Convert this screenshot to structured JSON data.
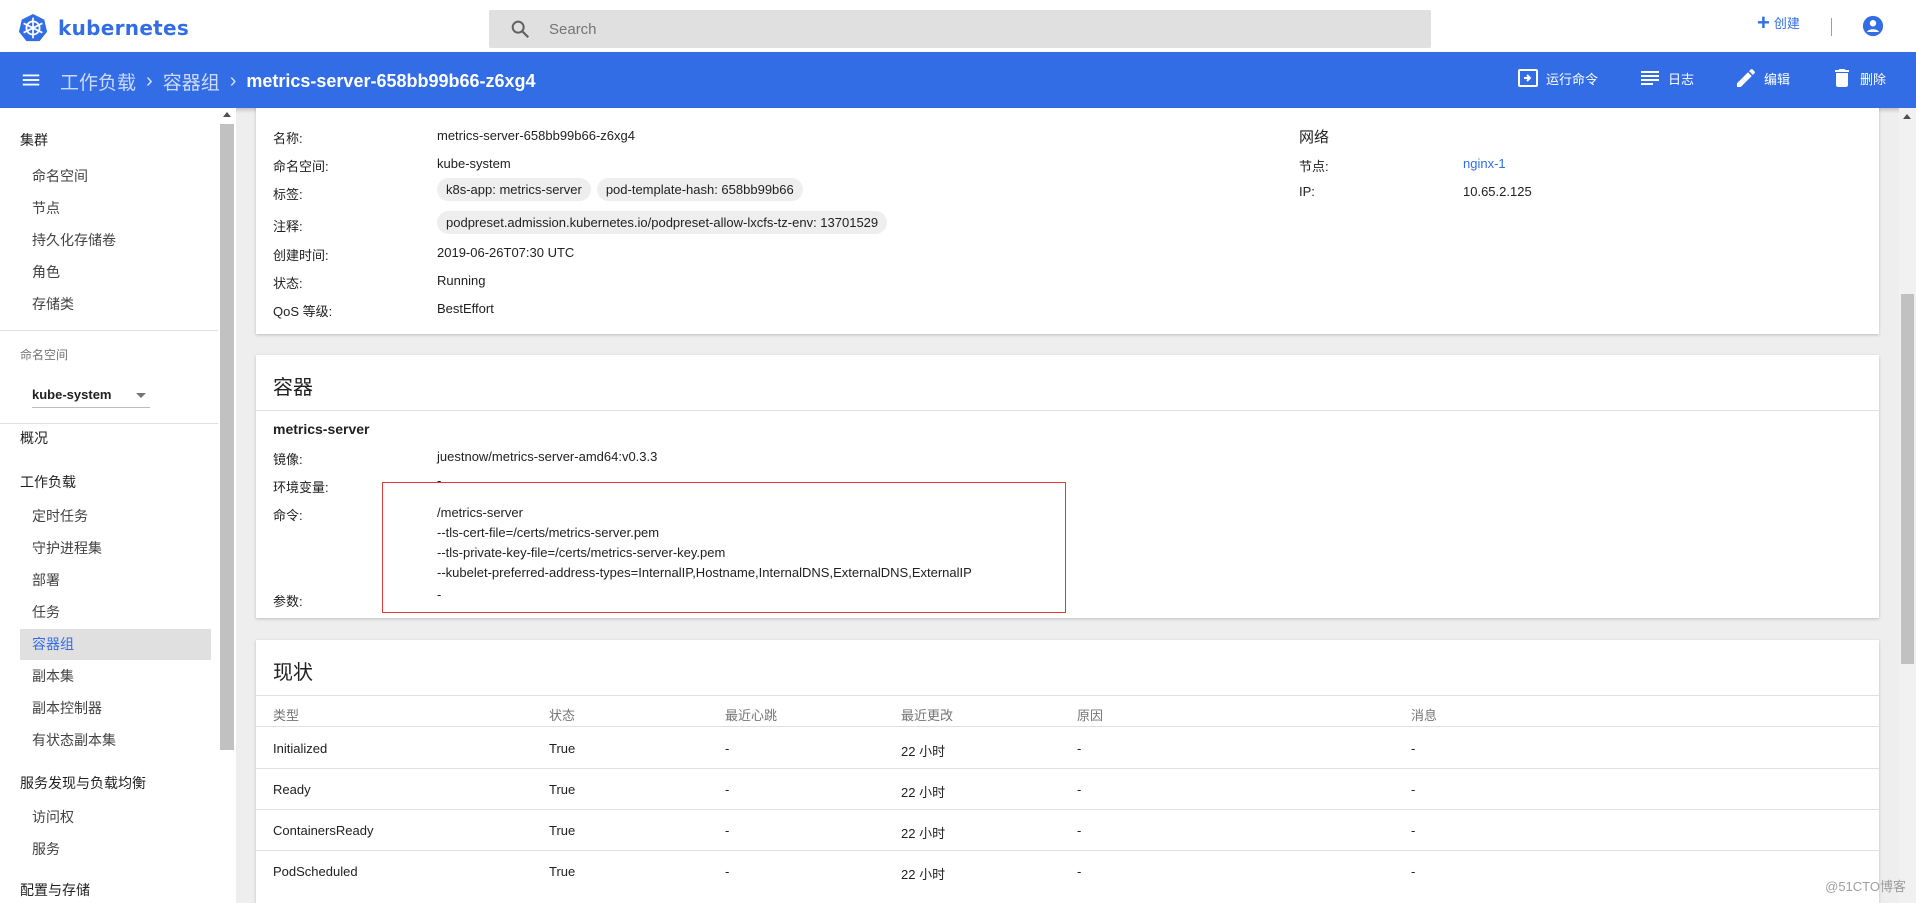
{
  "app": {
    "logo_text": "kubernetes",
    "search_placeholder": "Search",
    "create_label": "创建"
  },
  "toolbar": {
    "breadcrumb": [
      "工作负载",
      "容器组"
    ],
    "current": "metrics-server-658bb99b66-z6xg4",
    "actions": [
      {
        "icon": "exec-icon",
        "label": "运行命令"
      },
      {
        "icon": "logs-icon",
        "label": "日志"
      },
      {
        "icon": "edit-icon",
        "label": "编辑"
      },
      {
        "icon": "delete-icon",
        "label": "删除"
      }
    ]
  },
  "sidebar": {
    "cluster_title": "集群",
    "cluster_items": [
      "命名空间",
      "节点",
      "持久化存储卷",
      "角色",
      "存储类"
    ],
    "namespace_label": "命名空间",
    "namespace_value": "kube-system",
    "overview": "概况",
    "workloads_title": "工作负载",
    "workload_items": [
      "定时任务",
      "守护进程集",
      "部署",
      "任务",
      "容器组",
      "副本集",
      "副本控制器",
      "有状态副本集"
    ],
    "active_item": "容器组",
    "discovery_title": "服务发现与负载均衡",
    "discovery_items": [
      "访问权",
      "服务"
    ],
    "config_title": "配置与存储"
  },
  "metadata": {
    "name_label": "名称:",
    "name": "metrics-server-658bb99b66-z6xg4",
    "namespace_label": "命名空间:",
    "namespace": "kube-system",
    "labels_label": "标签:",
    "labels": [
      "k8s-app: metrics-server",
      "pod-template-hash: 658bb99b66"
    ],
    "annotations_label": "注释:",
    "annotations": [
      "podpreset.admission.kubernetes.io/podpreset-allow-lxcfs-tz-env:  13701529"
    ],
    "created_label": "创建时间:",
    "created": "2019-06-26T07:30 UTC",
    "status_label": "状态:",
    "status": "Running",
    "qos_label": "QoS 等级:",
    "qos": "BestEffort",
    "network_title": "网络",
    "node_label": "节点:",
    "node": "nginx-1",
    "ip_label": "IP:",
    "ip": "10.65.2.125"
  },
  "containers": {
    "title": "容器",
    "name": "metrics-server",
    "image_label": "镜像:",
    "image": "juestnow/metrics-server-amd64:v0.3.3",
    "env_label": "环境变量:",
    "env": "-",
    "command_label": "命令:",
    "command": [
      "/metrics-server",
      "--tls-cert-file=/certs/metrics-server.pem",
      "--tls-private-key-file=/certs/metrics-server-key.pem",
      "--kubelet-preferred-address-types=InternalIP,Hostname,InternalDNS,ExternalDNS,ExternalIP"
    ],
    "args_label": "参数:",
    "args": "-"
  },
  "conditions": {
    "title": "现状",
    "headers": [
      "类型",
      "状态",
      "最近心跳",
      "最近更改",
      "原因",
      "消息"
    ],
    "rows": [
      [
        "Initialized",
        "True",
        "-",
        "22 小时",
        "-",
        "-"
      ],
      [
        "Ready",
        "True",
        "-",
        "22 小时",
        "-",
        "-"
      ],
      [
        "ContainersReady",
        "True",
        "-",
        "22 小时",
        "-",
        "-"
      ],
      [
        "PodScheduled",
        "True",
        "-",
        "22 小时",
        "-",
        "-"
      ]
    ]
  },
  "watermark": "@51CTO博客",
  "colors": {
    "brand": "#326de6",
    "highlight_box": "#e53935"
  }
}
